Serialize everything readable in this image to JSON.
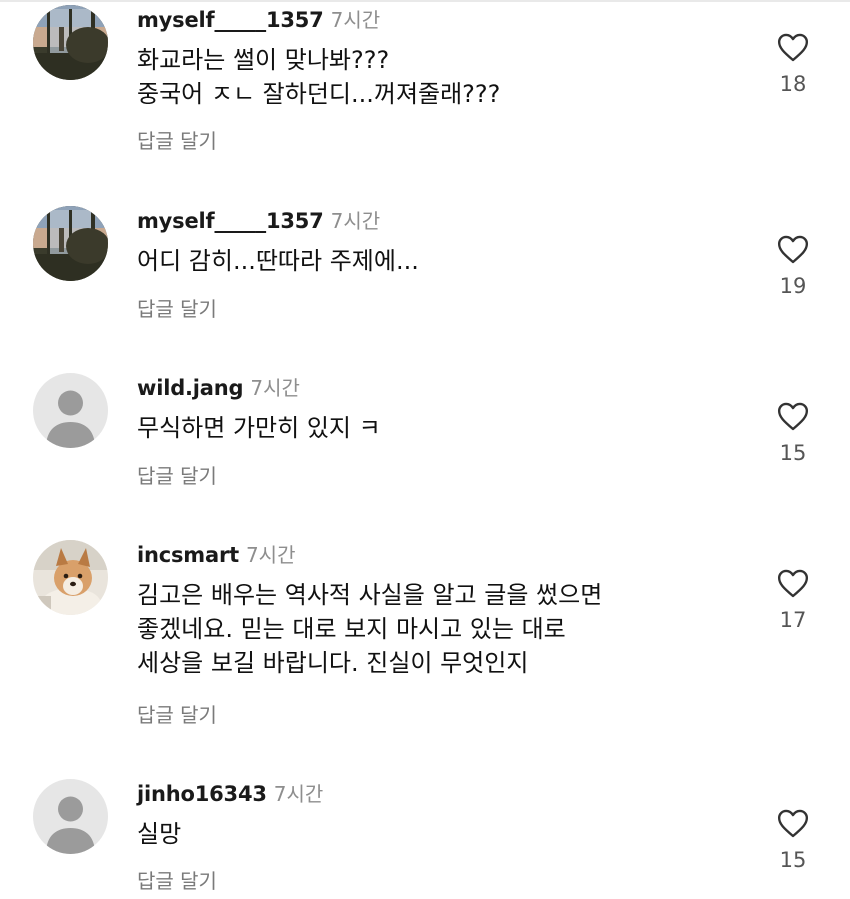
{
  "comments": [
    {
      "username": "myself_____1357",
      "time": "7시간",
      "lines": [
        "화교라는 썰이 맞나봐???",
        "중국어 ㅈㄴ 잘하던디...꺼져줄래???"
      ],
      "reply_label": "답글 달기",
      "likes": "18",
      "avatar": "window-photo"
    },
    {
      "username": "myself_____1357",
      "time": "7시간",
      "lines": [
        "어디 감히...딴따라 주제에..."
      ],
      "reply_label": "답글 달기",
      "likes": "19",
      "avatar": "window-photo"
    },
    {
      "username": "wild.jang",
      "time": "7시간",
      "lines": [
        "무식하면 가만히 있지 ㅋ"
      ],
      "reply_label": "답글 달기",
      "likes": "15",
      "avatar": "default-person"
    },
    {
      "username": "incsmart",
      "time": "7시간",
      "lines": [
        "김고은 배우는 역사적 사실을 알고 글을 썼으면",
        "좋겠네요. 믿는 대로 보지 마시고 있는 대로",
        "세상을 보길 바랍니다. 진실이 무엇인지"
      ],
      "reply_label": "답글 달기",
      "likes": "17",
      "avatar": "dog-photo"
    },
    {
      "username": "jinho16343",
      "time": "7시간",
      "lines": [
        "실망"
      ],
      "reply_label": "답글 달기",
      "likes": "15",
      "avatar": "default-person"
    }
  ],
  "icons": {
    "like": "heart-outline-icon",
    "default_avatar": "person-silhouette-icon"
  },
  "colors": {
    "time": "#8e8e8e",
    "reply": "#7a7a7a",
    "heart_stroke": "#333333",
    "default_avatar_bg": "#e6e6e6",
    "default_avatar_fg": "#9b9b9b"
  }
}
